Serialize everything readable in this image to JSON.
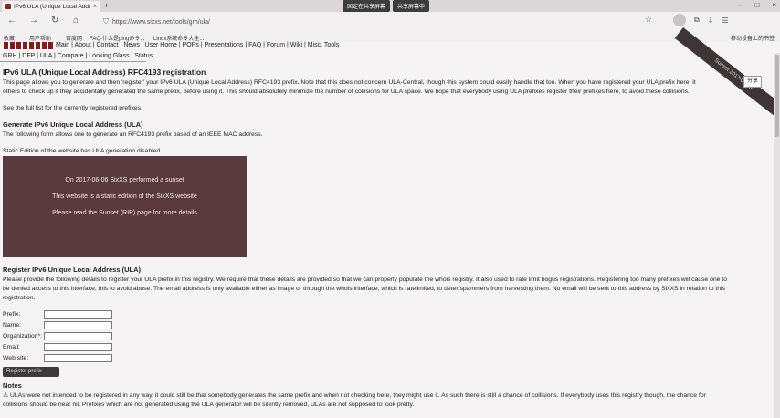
{
  "browser": {
    "tab_title": "IPv6 ULA (Unique Local Addre",
    "tab_close": "×",
    "new_tab": "+",
    "float_buttons": [
      "固定在共享屏幕",
      "共享屏幕中"
    ],
    "url": "https://www.sixxs.net/tools/grh/ula/",
    "bookmarks": [
      "收藏",
      "用户帮助",
      "百度网",
      "FAQ-什么是ping命令...",
      "Linux系统命令大全..."
    ],
    "bookmarks_right": "移动设备上的书签",
    "window_controls": [
      "–",
      "□",
      "×"
    ]
  },
  "site": {
    "menu_links": "Main | About | Contact | News | User Home | POPs | Presentations | FAQ | Forum | Wiki | Misc. Tools",
    "subnav": "GRH | DFP | ULA | Compare | Looking Glass | Status",
    "banner_text": "Sunset 2017-06-06",
    "share_button": "分享"
  },
  "content": {
    "title": "IPv6 ULA (Unique Local Address) RFC4193 registration",
    "intro_line1": "This page allows you to generate and then 'register' your IPv6 ULA (Unique Local Address) RFC4193 prefix. Note that this does not concern ULA-Central, though this system could easily handle that too. When you have registered your ULA prefix here, it",
    "intro_line2": "others to check up if they accidentally generated the same prefix, before using it. This should absolutely minimize the number of collisions for ULA space. We hope that everybody using ULA prefixes register their prefixes here, to avoid these collisions.",
    "see_full_list": "See the full list for the currently registered prefixes.",
    "gen_title": "Generate IPv6 Unique Local Address (ULA)",
    "gen_text": "The following form allows one to generate an RFC4193 prefix based of an IEEE MAC address.",
    "static_text": "Static Edition of the website has ULA generation disabled.",
    "image_lines": [
      "On 2017-06-06 SixXS performed a sunset",
      "This website is a static edition of the SixXS website",
      "Please read the Sunset (RIP) page for more details"
    ],
    "register_title": "Register IPv6 Unique Local Address (ULA)",
    "register_line1": "Please provide the following details to register your ULA prefix in this registry. We require that these details are provided so that we can properly populate the whois registry. It also used to rate limit bogus registrations. Registering too many prefixes will cause one to",
    "register_line2": "be denied access to this interface, this to avoid abuse. The email address is only available either as image or through the whois interface, which is ratelimited, to deter spammers from harvesting them. No email will be sent to this address by SixXS in relation to this",
    "register_line3": "registration.",
    "form": {
      "labels": [
        "Prefix:",
        "Name:",
        "Organization*:",
        "Email:",
        "Web site:"
      ],
      "submit": "Register prefix"
    },
    "notes_title": "Notes",
    "notes_line1": "⚠ ULAs were not intended to be registered in any way, it could still be that somebody generates the same prefix and when not checking here, they might use it. As such there is still a chance of collisions. If everybody uses this registry though, the chance for",
    "notes_line2": "collisions should be near nil. Prefixes which are not generated using the ULA generator will be silently removed, ULAs are not supposed to look pretty."
  }
}
